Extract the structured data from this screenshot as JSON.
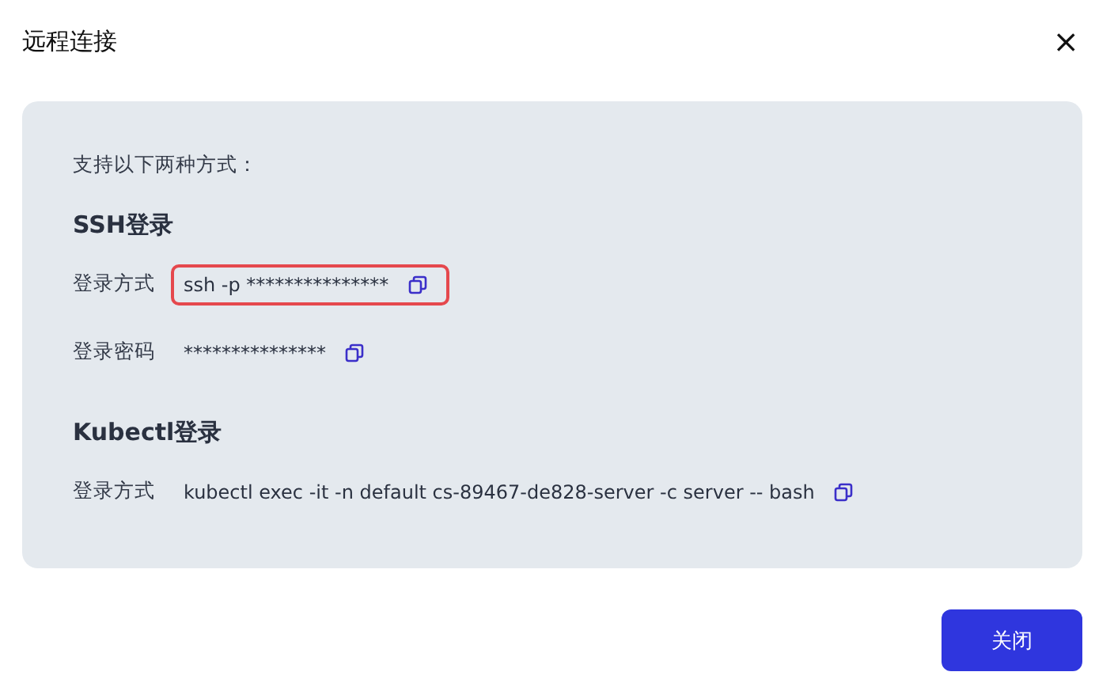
{
  "dialog": {
    "title": "远程连接",
    "close_icon": "×"
  },
  "intro": "支持以下两种方式：",
  "sections": [
    {
      "heading": "SSH登录",
      "rows": [
        {
          "label": "登录方式",
          "value": "ssh -p ***************",
          "highlighted": true
        },
        {
          "label": "登录密码",
          "value": "***************",
          "highlighted": false
        }
      ]
    },
    {
      "heading": "Kubectl登录",
      "rows": [
        {
          "label": "登录方式",
          "value": "kubectl exec -it -n default cs-89467-de828-server -c server -- bash",
          "highlighted": false
        }
      ]
    }
  ],
  "buttons": [
    "关闭"
  ]
}
